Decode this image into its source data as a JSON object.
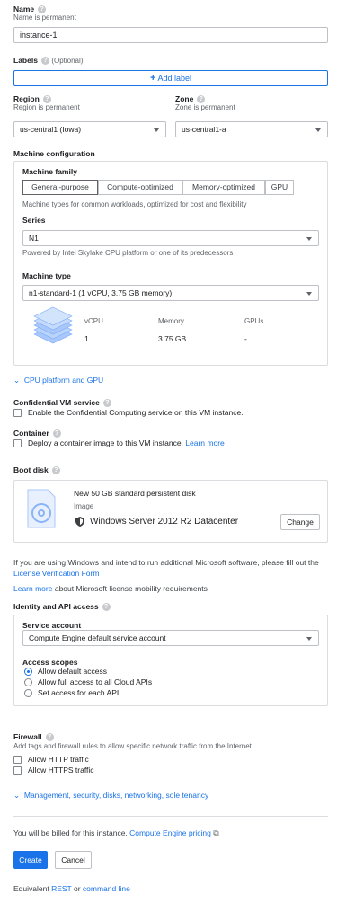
{
  "name": {
    "label": "Name",
    "sub": "Name is permanent",
    "value": "instance-1"
  },
  "labels": {
    "label": "Labels",
    "optional": "(Optional)",
    "add": "Add label"
  },
  "region": {
    "label": "Region",
    "sub": "Region is permanent",
    "value": "us-central1 (Iowa)"
  },
  "zone": {
    "label": "Zone",
    "sub": "Zone is permanent",
    "value": "us-central1-a"
  },
  "machine": {
    "title": "Machine configuration",
    "family_label": "Machine family",
    "tabs": [
      "General-purpose",
      "Compute-optimized",
      "Memory-optimized",
      "GPU"
    ],
    "family_desc": "Machine types for common workloads, optimized for cost and flexibility",
    "series_label": "Series",
    "series_value": "N1",
    "series_desc": "Powered by Intel Skylake CPU platform or one of its predecessors",
    "type_label": "Machine type",
    "type_value": "n1-standard-1 (1 vCPU, 3.75 GB memory)",
    "specs": {
      "vcpu_h": "vCPU",
      "mem_h": "Memory",
      "gpu_h": "GPUs",
      "vcpu": "1",
      "mem": "3.75 GB",
      "gpu": "-"
    },
    "cpu_link": "CPU platform and GPU"
  },
  "confidential": {
    "label": "Confidential VM service",
    "option": "Enable the Confidential Computing service on this VM instance."
  },
  "container": {
    "label": "Container",
    "option": "Deploy a container image to this VM instance.",
    "learn": "Learn more"
  },
  "boot": {
    "label": "Boot disk",
    "title": "New 50 GB standard persistent disk",
    "image_label": "Image",
    "image_value": "Windows Server 2012 R2 Datacenter",
    "change": "Change"
  },
  "windows": {
    "text1": "If you are using Windows and intend to run additional Microsoft software, please fill out the",
    "form_link": "License Verification Form",
    "learn_link": "Learn more",
    "text2": "about Microsoft license mobility requirements"
  },
  "identity": {
    "label": "Identity and API access",
    "sa_label": "Service account",
    "sa_value": "Compute Engine default service account",
    "scopes_label": "Access scopes",
    "scopes": [
      "Allow default access",
      "Allow full access to all Cloud APIs",
      "Set access for each API"
    ]
  },
  "firewall": {
    "label": "Firewall",
    "sub": "Add tags and firewall rules to allow specific network traffic from the Internet",
    "http": "Allow HTTP traffic",
    "https": "Allow HTTPS traffic"
  },
  "mgmt_link": "Management, security, disks, networking, sole tenancy",
  "billing": {
    "text": "You will be billed for this instance.",
    "link": "Compute Engine pricing"
  },
  "actions": {
    "create": "Create",
    "cancel": "Cancel"
  },
  "equivalent": {
    "text": "Equivalent",
    "rest": "REST",
    "or": "or",
    "cmd": "command line"
  }
}
